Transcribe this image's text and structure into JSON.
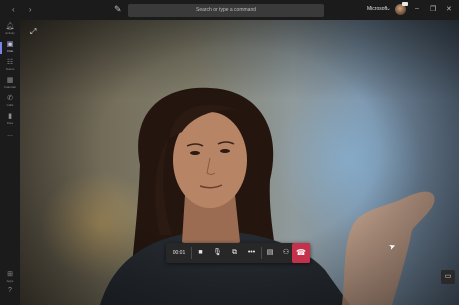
{
  "titlebar": {
    "back_icon": "chevron-left-icon",
    "forward_icon": "chevron-right-icon",
    "compose_icon": "compose-icon",
    "search_placeholder": "Search or type a command",
    "org_name": "Microsoft",
    "window_buttons": [
      "minimize-icon",
      "maximize-icon",
      "close-icon"
    ]
  },
  "rail": {
    "items": [
      {
        "icon": "bell-icon",
        "label": "Activity"
      },
      {
        "icon": "chat-icon",
        "label": "Chat",
        "active": true
      },
      {
        "icon": "teams-icon",
        "label": "Teams"
      },
      {
        "icon": "calendar-icon",
        "label": "Calendar"
      },
      {
        "icon": "phone-icon",
        "label": "Calls"
      },
      {
        "icon": "file-icon",
        "label": "Files"
      },
      {
        "icon": "more-icon",
        "label": "..."
      }
    ],
    "bottom_items": [
      {
        "icon": "apps-icon",
        "label": "Apps"
      },
      {
        "icon": "help-icon",
        "label": "Help"
      }
    ]
  },
  "call": {
    "timer": "00:01",
    "controls": [
      "video-icon",
      "mic-icon",
      "share-icon",
      "more-icon",
      "device-icon",
      "participants-icon"
    ],
    "hangup_icon": "hangup-icon"
  },
  "colors": {
    "accent": "#7b83eb",
    "hangup": "#c4314b",
    "chrome": "#1b1b1b"
  }
}
